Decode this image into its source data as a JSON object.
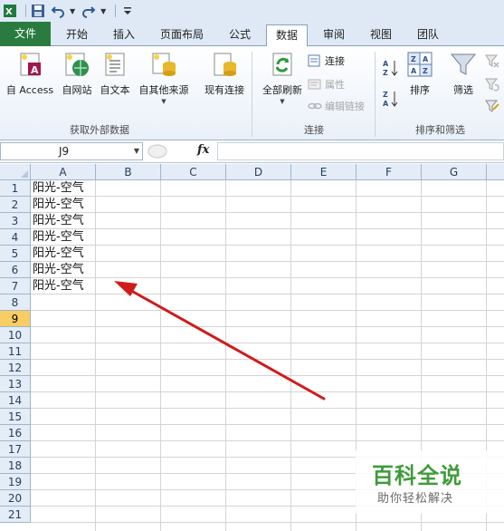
{
  "quick_access": {
    "icons": [
      "excel-icon",
      "save-icon",
      "undo-icon",
      "redo-icon",
      "customize-icon"
    ]
  },
  "tabs": [
    {
      "label": "文件"
    },
    {
      "label": "开始"
    },
    {
      "label": "插入"
    },
    {
      "label": "页面布局"
    },
    {
      "label": "公式"
    },
    {
      "label": "数据"
    },
    {
      "label": "审阅"
    },
    {
      "label": "视图"
    },
    {
      "label": "团队"
    }
  ],
  "active_tab": "数据",
  "ribbon": {
    "get_external": {
      "label": "获取外部数据",
      "buttons": [
        "自 Access",
        "自网站",
        "自文本",
        "自其他来源",
        "现有连接"
      ]
    },
    "connections": {
      "label": "连接",
      "refresh_all": "全部刷新",
      "connect": "连接",
      "properties": "属性",
      "edit_links": "编辑链接"
    },
    "sort_filter": {
      "label": "排序和筛选",
      "sort": "排序",
      "filter": "筛选"
    }
  },
  "formula_bar": {
    "name_box": "J9",
    "fx": "fx",
    "content": ""
  },
  "grid": {
    "columns": [
      "A",
      "B",
      "C",
      "D",
      "E",
      "F",
      "G"
    ],
    "rows": [
      "1",
      "2",
      "3",
      "4",
      "5",
      "6",
      "7",
      "8",
      "9",
      "10",
      "11",
      "12",
      "13",
      "14",
      "15",
      "16",
      "17",
      "18",
      "19",
      "20",
      "21"
    ],
    "selected_row": "9",
    "cells_a": [
      "阳光-空气",
      "阳光-空气",
      "阳光-空气",
      "阳光-空气",
      "阳光-空气",
      "阳光-空气",
      "阳光-空气"
    ]
  },
  "colors": {
    "file_tab": "#2a7b3f",
    "arrow": "#d11a1a",
    "selected_row": "#f8cd64",
    "watermark": "#3f9b3a"
  },
  "watermark": {
    "title": "百科全说",
    "subtitle": "助你轻松解决"
  }
}
